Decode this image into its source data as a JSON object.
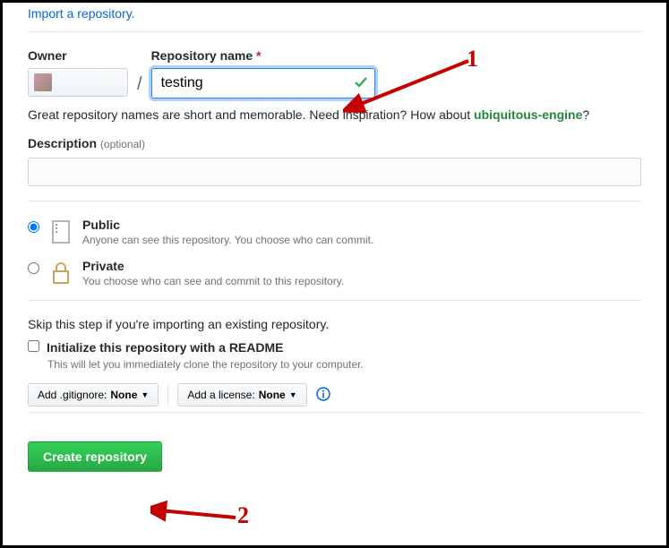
{
  "import_link": "Import a repository.",
  "labels": {
    "owner": "Owner",
    "repo_name": "Repository name",
    "description": "Description",
    "optional": "(optional)"
  },
  "repo_input_value": "testing",
  "hint_prefix": "Great repository names are short and memorable. Need inspiration? How about ",
  "hint_suggestion": "ubiquitous-engine",
  "hint_suffix": "?",
  "visibility": {
    "public": {
      "title": "Public",
      "desc": "Anyone can see this repository. You choose who can commit."
    },
    "private": {
      "title": "Private",
      "desc": "You choose who can see and commit to this repository."
    }
  },
  "skip_text": "Skip this step if you're importing an existing repository.",
  "readme": {
    "label": "Initialize this repository with a README",
    "desc": "This will let you immediately clone the repository to your computer."
  },
  "dropdowns": {
    "gitignore_prefix": "Add .gitignore: ",
    "gitignore_value": "None",
    "license_prefix": "Add a license: ",
    "license_value": "None"
  },
  "create_button": "Create repository",
  "annotations": {
    "num1": "1",
    "num2": "2"
  }
}
